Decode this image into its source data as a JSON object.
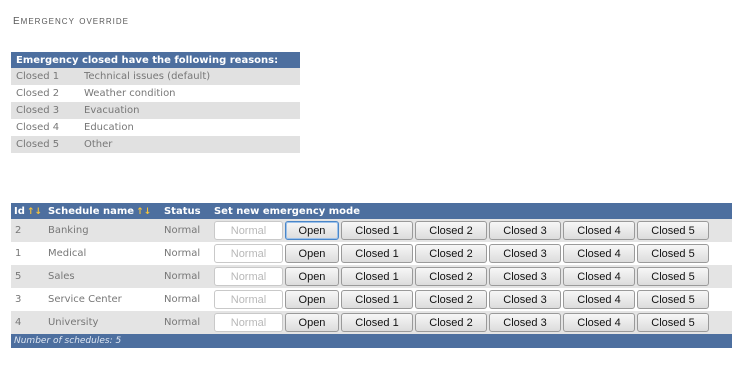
{
  "page": {
    "title": "Emergency override"
  },
  "reasons": {
    "header": "Emergency closed have the following reasons:",
    "items": [
      {
        "code": "Closed 1",
        "label": "Technical issues (default)"
      },
      {
        "code": "Closed 2",
        "label": "Weather condition"
      },
      {
        "code": "Closed 3",
        "label": "Evacuation"
      },
      {
        "code": "Closed 4",
        "label": "Education"
      },
      {
        "code": "Closed 5",
        "label": "Other"
      }
    ]
  },
  "schedules": {
    "columns": {
      "id": "Id",
      "name": "Schedule name",
      "status": "Status",
      "mode": "Set new emergency mode"
    },
    "sort_icon": "↑↓",
    "buttons": {
      "current": "Normal",
      "open": "Open",
      "closed": [
        "Closed 1",
        "Closed 2",
        "Closed 3",
        "Closed 4",
        "Closed 5"
      ]
    },
    "rows": [
      {
        "id": "2",
        "name": "Banking",
        "status": "Normal"
      },
      {
        "id": "1",
        "name": "Medical",
        "status": "Normal"
      },
      {
        "id": "5",
        "name": "Sales",
        "status": "Normal"
      },
      {
        "id": "3",
        "name": "Service Center",
        "status": "Normal"
      },
      {
        "id": "4",
        "name": "University",
        "status": "Normal"
      }
    ],
    "footer": "Number of schedules: 5"
  }
}
